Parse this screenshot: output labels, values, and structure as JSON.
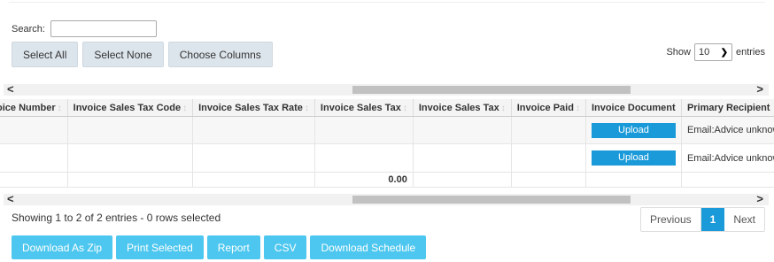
{
  "search": {
    "label": "Search:",
    "value": "",
    "placeholder": ""
  },
  "toolbar": {
    "select_all": "Select All",
    "select_none": "Select None",
    "choose_columns": "Choose Columns"
  },
  "length": {
    "show": "Show",
    "value": "10",
    "entries": "entries"
  },
  "scroll": {
    "left": "<",
    "right": ">"
  },
  "columns": [
    "oice Number",
    "Invoice Sales Tax Code",
    "Invoice Sales Tax Rate",
    "Invoice Sales Tax",
    "Invoice Sales Tax",
    "Invoice Paid",
    "Invoice Document",
    "Primary Recipient"
  ],
  "rows": [
    {
      "upload": "Upload",
      "recipient": "Email:Advice unknown:demo@a"
    },
    {
      "upload": "Upload",
      "recipient": "Email:Advice unknown:demo@a"
    }
  ],
  "footer": {
    "sales_tax_total": "0.00"
  },
  "info": "Showing 1 to 2 of 2 entries - 0 rows selected",
  "pagination": {
    "previous": "Previous",
    "current": "1",
    "next": "Next"
  },
  "actions": {
    "zip": "Download As Zip",
    "print": "Print Selected",
    "report": "Report",
    "csv": "CSV",
    "schedule": "Download Schedule"
  },
  "colors": {
    "primary": "#1a9ad8",
    "action": "#4dc7ef",
    "grey_button": "#dde5ec"
  }
}
